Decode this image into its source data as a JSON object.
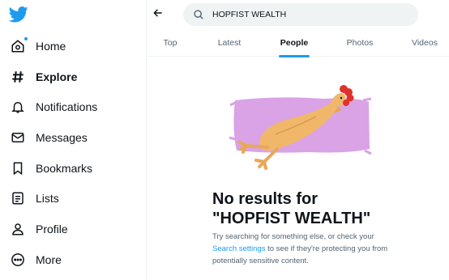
{
  "nav": {
    "items": [
      {
        "key": "home",
        "label": "Home",
        "icon": "home-icon",
        "active": false
      },
      {
        "key": "explore",
        "label": "Explore",
        "icon": "hashtag-icon",
        "active": true
      },
      {
        "key": "notifications",
        "label": "Notifications",
        "icon": "bell-icon",
        "active": false
      },
      {
        "key": "messages",
        "label": "Messages",
        "icon": "envelope-icon",
        "active": false
      },
      {
        "key": "bookmarks",
        "label": "Bookmarks",
        "icon": "bookmark-icon",
        "active": false
      },
      {
        "key": "lists",
        "label": "Lists",
        "icon": "list-icon",
        "active": false
      },
      {
        "key": "profile",
        "label": "Profile",
        "icon": "person-icon",
        "active": false
      },
      {
        "key": "more",
        "label": "More",
        "icon": "more-circle-icon",
        "active": false
      }
    ]
  },
  "search": {
    "value": "HOPFIST WEALTH"
  },
  "tabs": [
    {
      "label": "Top",
      "active": false
    },
    {
      "label": "Latest",
      "active": false
    },
    {
      "label": "People",
      "active": true
    },
    {
      "label": "Photos",
      "active": false
    },
    {
      "label": "Videos",
      "active": false
    }
  ],
  "empty": {
    "title_line1": "No results for",
    "title_line2": "\"HOPFIST WEALTH\"",
    "sub_before": "Try searching for something else, or check your ",
    "sub_link": "Search settings",
    "sub_after": " to see if they're protecting you from potentially sensitive content."
  },
  "colors": {
    "accent": "#1d9bf0",
    "text": "#0f1419",
    "muted": "#536471",
    "purple": "#d9a3e6"
  }
}
